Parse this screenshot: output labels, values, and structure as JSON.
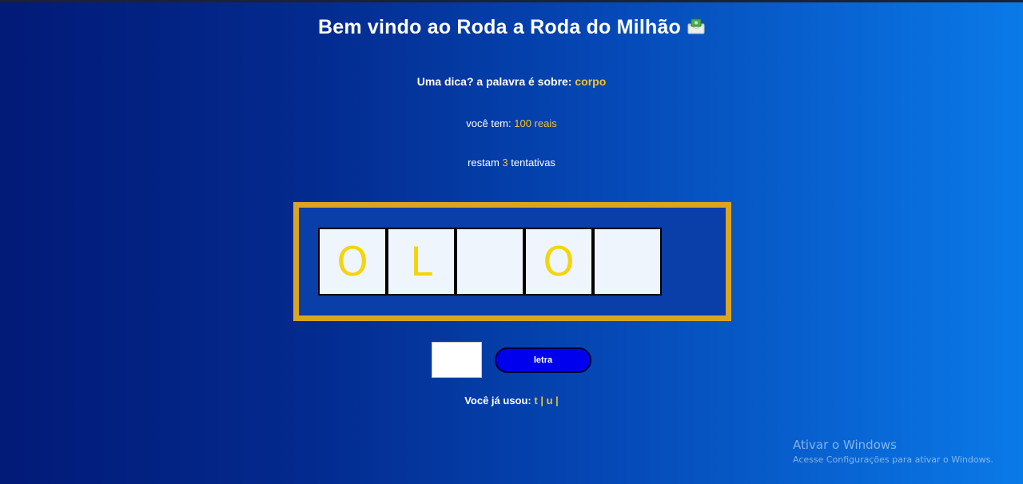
{
  "header": {
    "title": "Bem vindo ao Roda a Roda do Milhão",
    "title_icon": "envelope-money-icon"
  },
  "hint": {
    "prefix": "Uma dica? a palavra é sobre:",
    "topic": "corpo"
  },
  "money": {
    "prefix": "você tem:",
    "amount": "100 reais"
  },
  "attempts": {
    "prefix": "restam",
    "count": "3",
    "suffix": "tentativas"
  },
  "board": {
    "cells": [
      "O",
      "L",
      "",
      "O",
      ""
    ]
  },
  "guess": {
    "input_value": "",
    "button_label": "letra"
  },
  "used_letters": {
    "prefix": "Você já usou:",
    "letters": "t | u |"
  },
  "watermark": {
    "line1": "Ativar o Windows",
    "line2": "Acesse Configurações para ativar o Windows."
  },
  "colors": {
    "accent_gold": "#f2c230",
    "board_border": "#daa520",
    "letter_color": "#f5d40d",
    "button_blue": "#0000ee"
  }
}
